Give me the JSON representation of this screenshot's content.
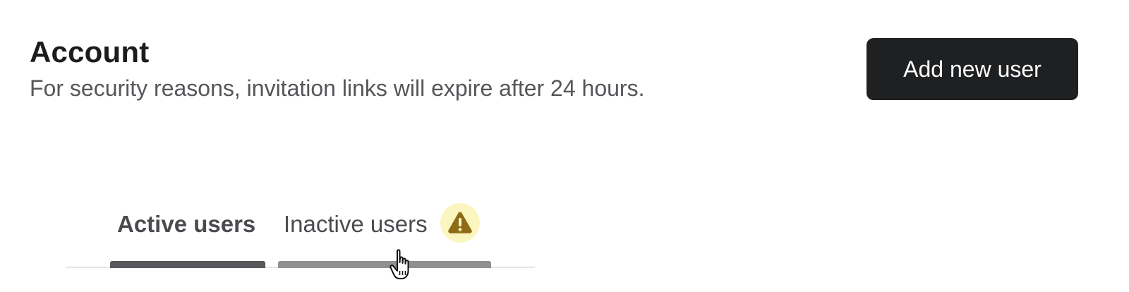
{
  "header": {
    "title": "Account",
    "subtitle": "For security reasons, invitation links will expire after 24 hours."
  },
  "actions": {
    "add_user_label": "Add new user"
  },
  "tabs": [
    {
      "label": "Active users",
      "selected": true
    },
    {
      "label": "Inactive users",
      "selected": false,
      "badge_icon": "warning-icon"
    }
  ],
  "colors": {
    "button_bg": "#1f2022",
    "warning_badge_bg": "#fbf6bf",
    "warning_icon": "#8e6c17",
    "active_indicator": "#58595c",
    "hover_indicator": "#8f9092"
  },
  "cursor": {
    "icon": "hand-pointer-cursor"
  }
}
